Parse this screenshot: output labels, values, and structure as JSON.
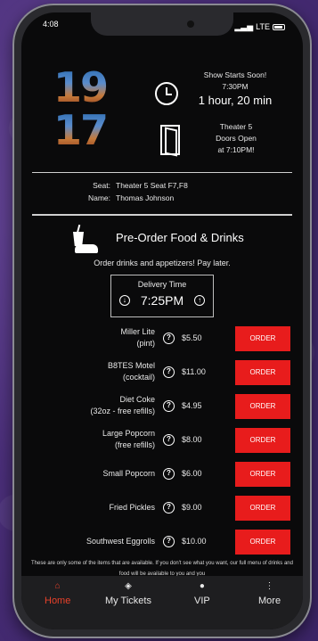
{
  "status_bar": {
    "time": "4:08",
    "network": "LTE"
  },
  "poster": {
    "top_number": "19",
    "bottom_number": "17"
  },
  "showtime": {
    "line1": "Show Starts Soon!",
    "line2": "7:30PM",
    "countdown": "1 hour, 20 min"
  },
  "theater": {
    "line1": "Theater 5",
    "line2": "Doors Open",
    "line3": "at 7:10PM!"
  },
  "seat_info": {
    "seat_label": "Seat:",
    "seat_value": "Theater 5 Seat F7,F8",
    "name_label": "Name:",
    "name_value": "Thomas Johnson"
  },
  "preorder": {
    "title": "Pre-Order Food & Drinks",
    "subtitle": "Order drinks and appetizers! Pay later.",
    "delivery_label": "Delivery Time",
    "delivery_time": "7:25PM"
  },
  "menu_items": [
    {
      "name_line1": "Miller Lite",
      "name_line2": "(pint)",
      "price": "$5.50",
      "button": "ORDER"
    },
    {
      "name_line1": "B8TES Motel",
      "name_line2": "(cocktail)",
      "price": "$11.00",
      "button": "ORDER"
    },
    {
      "name_line1": "Diet Coke",
      "name_line2": "(32oz - free refills)",
      "price": "$4.95",
      "button": "ORDER"
    },
    {
      "name_line1": "Large Popcorn",
      "name_line2": "(free refills)",
      "price": "$8.00",
      "button": "ORDER"
    },
    {
      "name_line1": "Small Popcorn",
      "name_line2": "",
      "price": "$6.00",
      "button": "ORDER"
    },
    {
      "name_line1": "Fried Pickles",
      "name_line2": "",
      "price": "$9.00",
      "button": "ORDER"
    },
    {
      "name_line1": "Southwest Eggrolls",
      "name_line2": "",
      "price": "$10.00",
      "button": "ORDER"
    }
  ],
  "disclaimer": "These are only some of the items that are available. If you don't see what you want, our full menu of drinks and food will be available to you and you",
  "tabs": [
    {
      "label": "Home",
      "icon": "home-icon",
      "active": true
    },
    {
      "label": "My Tickets",
      "icon": "ticket-icon",
      "active": false
    },
    {
      "label": "VIP",
      "icon": "person-icon",
      "active": false
    },
    {
      "label": "More",
      "icon": "more-icon",
      "active": false
    }
  ],
  "colors": {
    "accent": "#e81c1c",
    "active_tab": "#e8412a",
    "background": "#0a0a0b"
  }
}
